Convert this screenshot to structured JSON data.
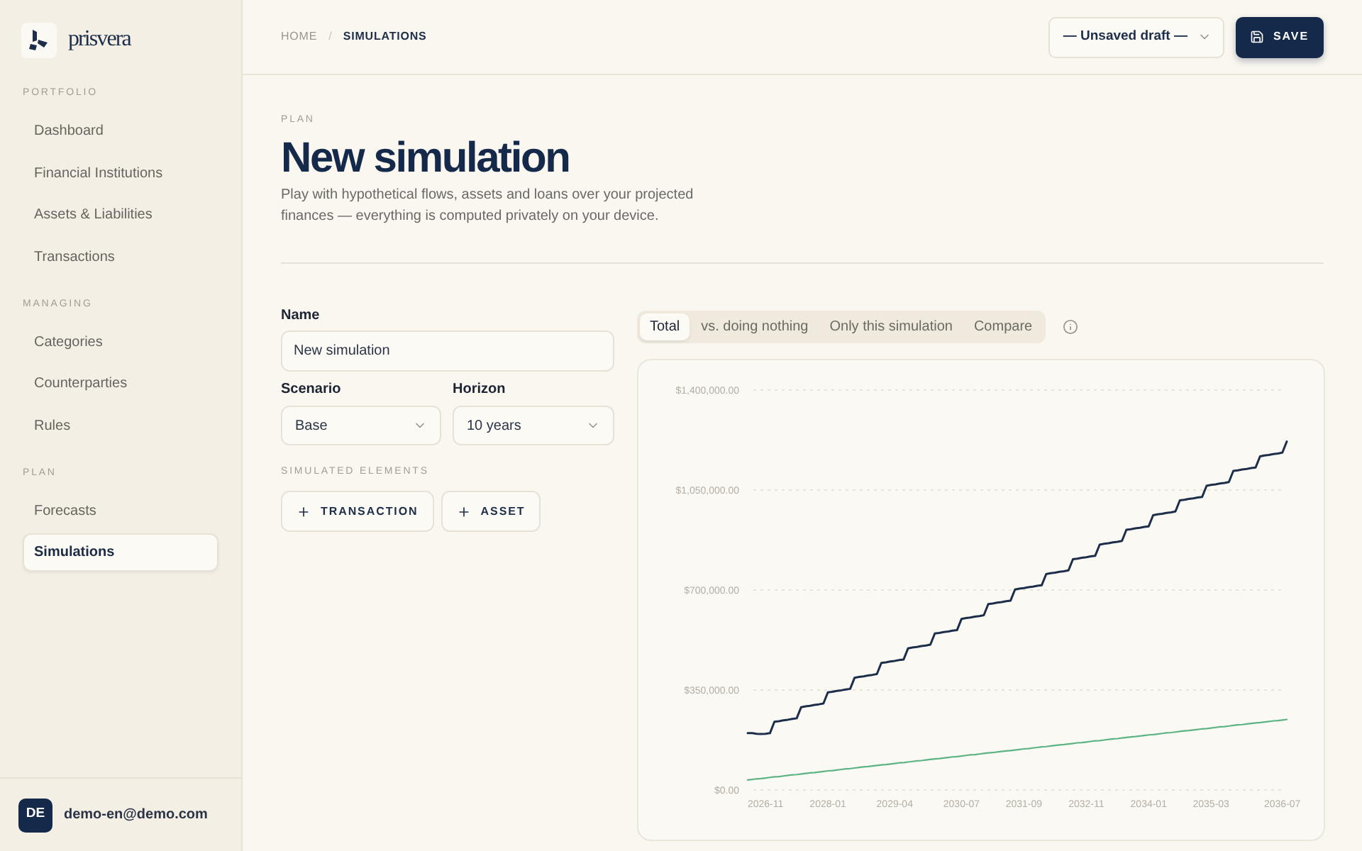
{
  "sidebar": {
    "brand": "prisvera",
    "sections": [
      {
        "title": "PORTFOLIO",
        "items": [
          {
            "label": "Dashboard",
            "selected": false
          },
          {
            "label": "Financial Institutions",
            "selected": false
          },
          {
            "label": "Assets & Liabilities",
            "selected": false
          },
          {
            "label": "Transactions",
            "selected": false
          }
        ]
      },
      {
        "title": "MANAGING",
        "items": [
          {
            "label": "Categories",
            "selected": false
          },
          {
            "label": "Counterparties",
            "selected": false
          },
          {
            "label": "Rules",
            "selected": false
          }
        ]
      },
      {
        "title": "PLAN",
        "items": [
          {
            "label": "Forecasts",
            "selected": false
          },
          {
            "label": "Simulations",
            "selected": true
          }
        ]
      }
    ],
    "user": {
      "initials": "DE",
      "email": "demo-en@demo.com"
    }
  },
  "header": {
    "breadcrumb": [
      {
        "label": "HOME",
        "current": false
      },
      {
        "label": "SIMULATIONS",
        "current": true
      }
    ],
    "breadcrumb_separator": "/",
    "draft_select": {
      "value": "— Unsaved draft —"
    },
    "save_button": {
      "label": "SAVE"
    }
  },
  "page": {
    "eyebrow": "PLAN",
    "title": "New simulation",
    "description": "Play with hypothetical flows, assets and loans over your projected finances — everything is computed privately on your device."
  },
  "form": {
    "name": {
      "label": "Name",
      "value": "New simulation"
    },
    "scenario": {
      "label": "Scenario",
      "value": "Base"
    },
    "horizon": {
      "label": "Horizon",
      "value": "10 years"
    },
    "elements_title": "SIMULATED ELEMENTS",
    "add_buttons": [
      {
        "label": "TRANSACTION"
      },
      {
        "label": "ASSET"
      }
    ]
  },
  "chart": {
    "tabs": [
      {
        "label": "Total",
        "selected": true
      },
      {
        "label": "vs. doing nothing",
        "selected": false
      },
      {
        "label": "Only this simulation",
        "selected": false
      },
      {
        "label": "Compare",
        "selected": false
      }
    ],
    "chart_data": {
      "type": "line",
      "grid": true,
      "categories": [
        null,
        null,
        null,
        null,
        "2026-11",
        null,
        null,
        null,
        null,
        null,
        null,
        null,
        null,
        null,
        null,
        null,
        null,
        null,
        "2028-01",
        null,
        null,
        null,
        null,
        null,
        null,
        null,
        null,
        null,
        null,
        null,
        null,
        null,
        null,
        "2029-04",
        null,
        null,
        null,
        null,
        null,
        null,
        null,
        null,
        null,
        null,
        null,
        null,
        null,
        null,
        "2030-07",
        null,
        null,
        null,
        null,
        null,
        null,
        null,
        null,
        null,
        null,
        null,
        null,
        null,
        "2031-09",
        null,
        null,
        null,
        null,
        null,
        null,
        null,
        null,
        null,
        null,
        null,
        null,
        null,
        "2032-11",
        null,
        null,
        null,
        null,
        null,
        null,
        null,
        null,
        null,
        null,
        null,
        null,
        null,
        "2034-01",
        null,
        null,
        null,
        null,
        null,
        null,
        null,
        null,
        null,
        null,
        null,
        null,
        null,
        "2035-03",
        null,
        null,
        null,
        null,
        null,
        null,
        null,
        null,
        null,
        null,
        null,
        null,
        null,
        null,
        null,
        "2036-07",
        null
      ],
      "ylim": [
        0,
        1400000
      ],
      "yticks": [
        {
          "value": 0,
          "label": "$0.00"
        },
        {
          "value": 350000,
          "label": "$350,000.00"
        },
        {
          "value": 700000,
          "label": "$700,000.00"
        },
        {
          "value": 1050000,
          "label": "$1,050,000.00"
        },
        {
          "value": 1400000,
          "label": "$1,400,000.00"
        }
      ],
      "series": [
        {
          "color": "#1c2e4a",
          "values": [
            199000,
            199000,
            197000,
            196000,
            197000,
            199000,
            239000,
            241000,
            244000,
            246000,
            249000,
            251000,
            290000,
            293000,
            295000,
            298000,
            300000,
            303000,
            342000,
            344000,
            347000,
            349000,
            352000,
            354000,
            393000,
            396000,
            398000,
            401000,
            403000,
            406000,
            445000,
            447000,
            450000,
            452000,
            455000,
            457000,
            496000,
            499000,
            501000,
            504000,
            506000,
            509000,
            548000,
            550000,
            553000,
            555000,
            558000,
            560000,
            599000,
            602000,
            604000,
            607000,
            609000,
            612000,
            651000,
            653000,
            656000,
            658000,
            661000,
            663000,
            702000,
            705000,
            707000,
            710000,
            712000,
            715000,
            717000,
            756000,
            759000,
            761000,
            764000,
            766000,
            769000,
            808000,
            810000,
            813000,
            815000,
            818000,
            820000,
            859000,
            862000,
            864000,
            867000,
            869000,
            872000,
            911000,
            913000,
            916000,
            918000,
            921000,
            923000,
            962000,
            965000,
            967000,
            970000,
            972000,
            975000,
            1014000,
            1016000,
            1019000,
            1021000,
            1024000,
            1026000,
            1065000,
            1068000,
            1070000,
            1073000,
            1075000,
            1078000,
            1117000,
            1119000,
            1122000,
            1124000,
            1127000,
            1129000,
            1168000,
            1171000,
            1173000,
            1176000,
            1178000,
            1181000,
            1220000
          ]
        },
        {
          "color": "#5cb483",
          "values": [
            35000,
            37000,
            39000,
            40000,
            42000,
            44000,
            46000,
            47000,
            49000,
            51000,
            53000,
            54000,
            56000,
            58000,
            60000,
            61000,
            63000,
            65000,
            67000,
            68000,
            70000,
            72000,
            74000,
            75000,
            77000,
            79000,
            81000,
            82000,
            84000,
            86000,
            88000,
            89000,
            91000,
            93000,
            95000,
            96000,
            98000,
            100000,
            102000,
            103000,
            105000,
            107000,
            109000,
            110000,
            112000,
            114000,
            116000,
            117000,
            119000,
            121000,
            123000,
            124000,
            126000,
            128000,
            130000,
            131000,
            133000,
            135000,
            137000,
            138000,
            140000,
            142000,
            144000,
            145000,
            147000,
            149000,
            151000,
            152000,
            154000,
            156000,
            158000,
            159000,
            161000,
            163000,
            165000,
            166000,
            168000,
            170000,
            172000,
            173000,
            175000,
            177000,
            179000,
            180000,
            182000,
            184000,
            186000,
            187000,
            189000,
            191000,
            193000,
            194000,
            196000,
            198000,
            200000,
            201000,
            203000,
            205000,
            207000,
            208000,
            210000,
            212000,
            214000,
            215000,
            217000,
            219000,
            221000,
            222000,
            224000,
            226000,
            228000,
            229000,
            231000,
            233000,
            235000,
            236000,
            238000,
            240000,
            242000,
            243000,
            245000,
            247000
          ]
        }
      ]
    }
  }
}
